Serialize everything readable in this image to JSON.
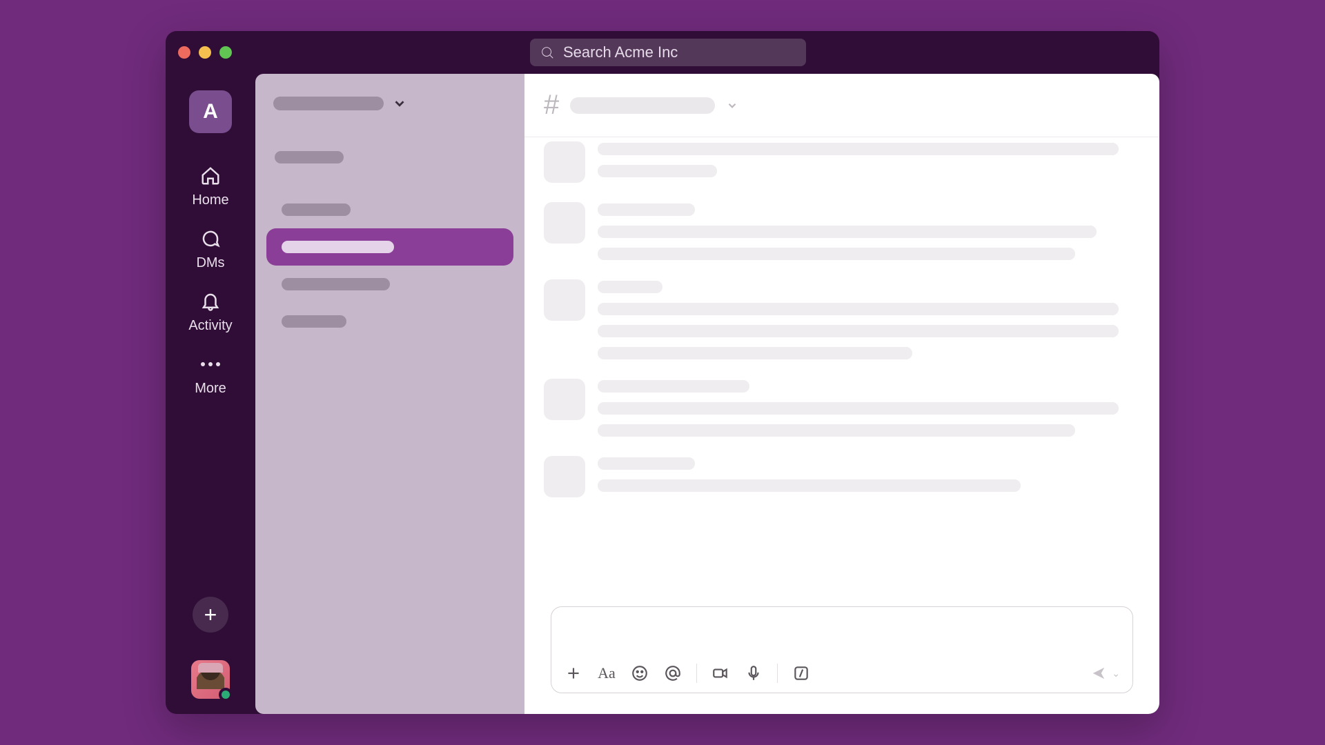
{
  "search": {
    "placeholder": "Search Acme Inc"
  },
  "workspace": {
    "initial": "A"
  },
  "rail": {
    "home": "Home",
    "dms": "DMs",
    "activity": "Activity",
    "more": "More"
  },
  "channel_list": {
    "active_index": 1,
    "items": [
      {
        "width_pct": 32
      },
      {
        "width_pct": 52
      },
      {
        "width_pct": 50
      },
      {
        "width_pct": 30
      }
    ]
  },
  "messages": [
    {
      "lines": [
        96,
        22
      ]
    },
    {
      "lines": [
        18,
        92,
        88
      ]
    },
    {
      "lines": [
        12,
        96,
        96,
        58
      ]
    },
    {
      "lines": [
        28,
        96,
        88
      ]
    },
    {
      "lines": [
        18,
        78
      ]
    }
  ],
  "icons": {
    "search": "search-icon",
    "home": "home-icon",
    "dms": "dms-icon",
    "activity": "bell-icon",
    "plus": "plus-icon",
    "hash": "hash-icon",
    "formatting": "formatting-icon",
    "emoji": "emoji-icon",
    "mention": "mention-icon",
    "video": "video-icon",
    "mic": "microphone-icon",
    "slash": "slash-command-icon",
    "send": "send-icon"
  },
  "colors": {
    "page_bg": "#702b7c",
    "window_bg": "#2f0d36",
    "sidebar_bg": "#c6b8ca",
    "active_channel": "#8b3e97",
    "presence": "#2bac76"
  }
}
